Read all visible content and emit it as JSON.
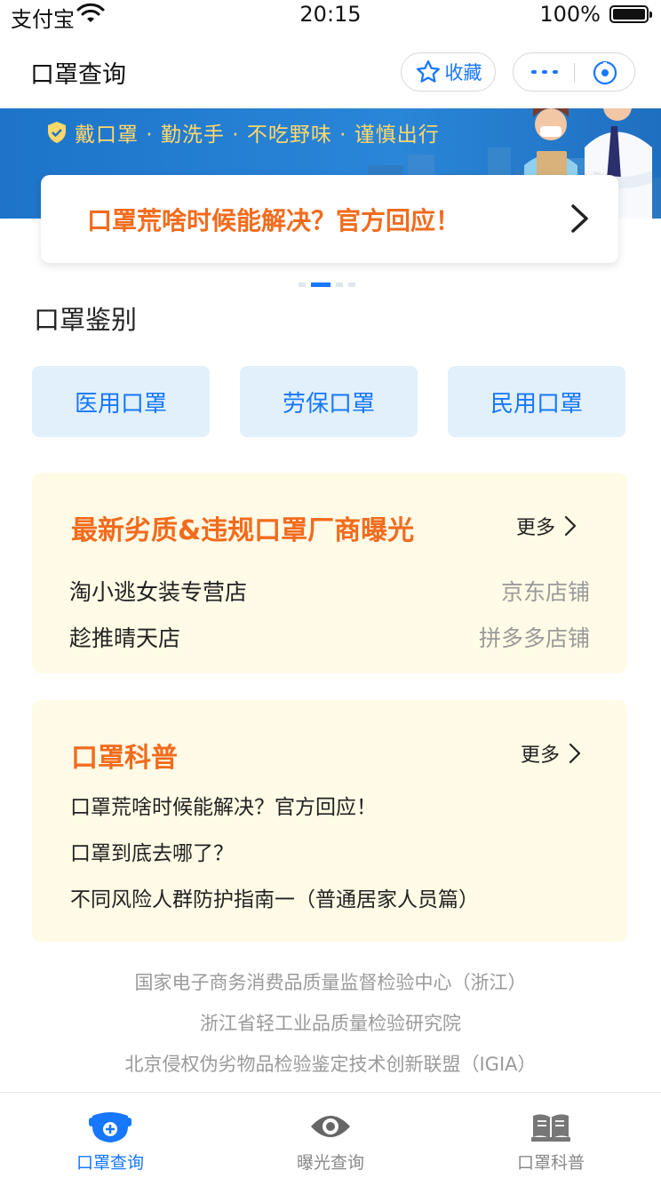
{
  "status_bar": {
    "carrier": "支付宝",
    "time": "20:15",
    "battery": "100%"
  },
  "nav": {
    "title": "口罩查询",
    "favorite_label": "收藏"
  },
  "banner": {
    "slogan": "戴口罩 · 勤洗手 · 不吃野味 · 谨慎出行",
    "headline": "口罩荒啥时候能解决？官方回应！",
    "carousel_index": 2,
    "carousel_count": 4
  },
  "identify": {
    "title": "口罩鉴别",
    "buttons": [
      "医用口罩",
      "劳保口罩",
      "民用口罩"
    ]
  },
  "exposure": {
    "title": "最新劣质&违规口罩厂商曝光",
    "more": "更多",
    "rows": [
      {
        "name": "淘小逃女装专营店",
        "platform": "京东店铺"
      },
      {
        "name": "趁推晴天店",
        "platform": "拼多多店铺"
      }
    ]
  },
  "science": {
    "title": "口罩科普",
    "more": "更多",
    "articles": [
      "口罩荒啥时候能解决？官方回应！",
      "口罩到底去哪了？",
      "不同风险人群防护指南一（普通居家人员篇）"
    ]
  },
  "orgs": [
    "国家电子商务消费品质量监督检验中心（浙江）",
    "浙江省轻工业品质量检验研究院",
    "北京侵权伪劣物品检验鉴定技术创新联盟（IGIA）"
  ],
  "tabs": [
    {
      "label": "口罩查询",
      "icon": "mask-query-icon",
      "active": true
    },
    {
      "label": "曝光查询",
      "icon": "eye-icon",
      "active": false
    },
    {
      "label": "口罩科普",
      "icon": "book-icon",
      "active": false
    }
  ],
  "colors": {
    "accent": "#1677ff",
    "orange": "#f26b1d",
    "card_bg": "#fffbe6",
    "banner_blue": "#1d74c9"
  }
}
